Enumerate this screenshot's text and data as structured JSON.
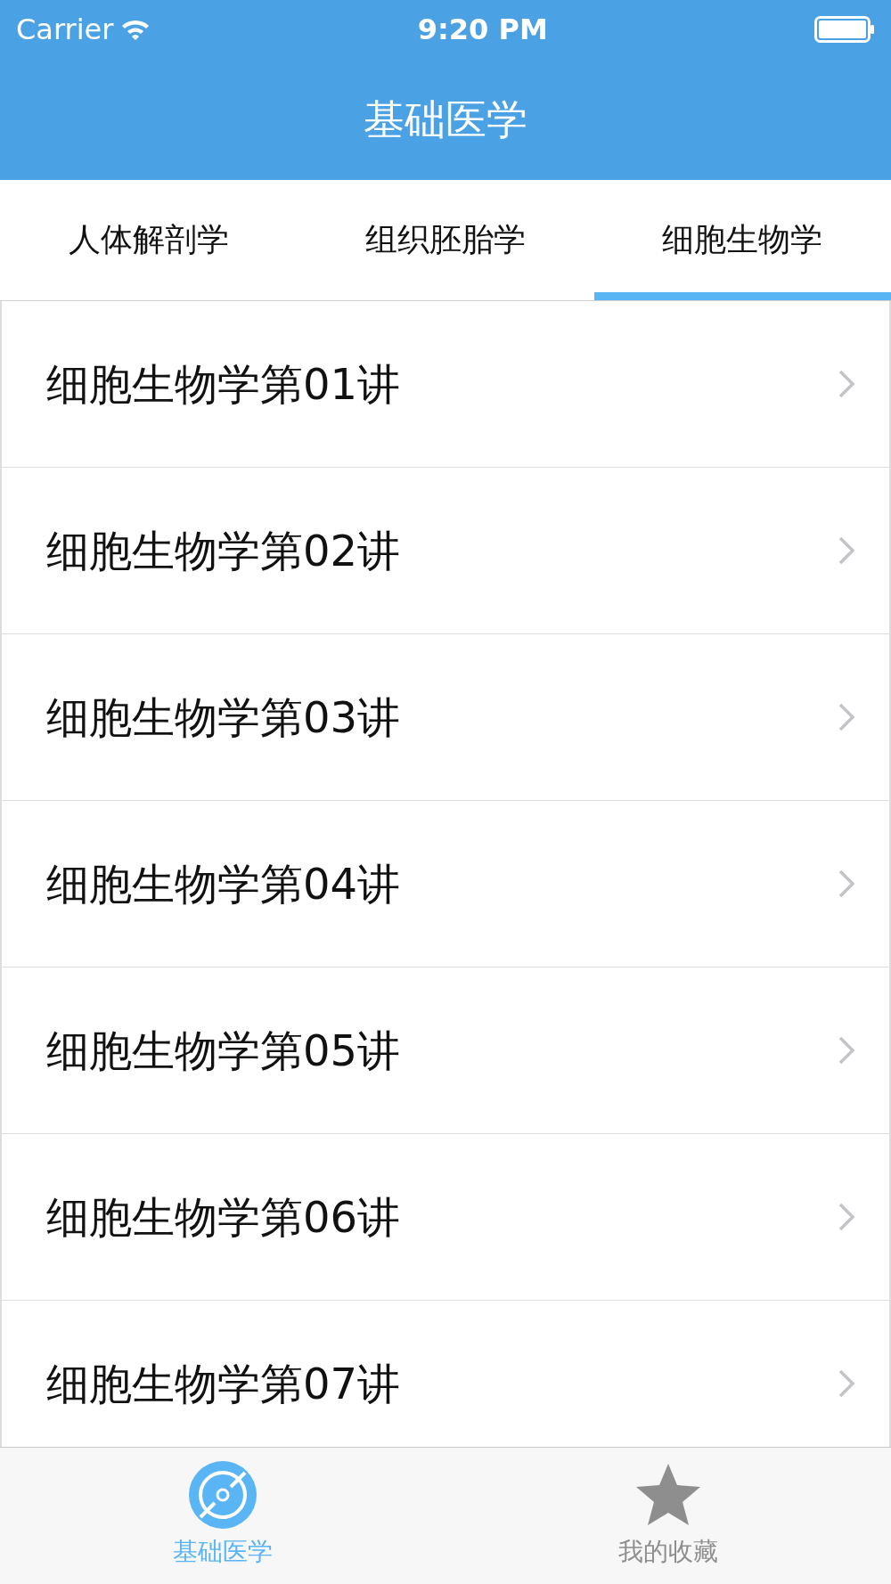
{
  "status_bar": {
    "carrier": "Carrier",
    "time": "9:20 PM"
  },
  "nav": {
    "title": "基础医学"
  },
  "tabs": [
    {
      "label": "人体解剖学",
      "selected": false
    },
    {
      "label": "组织胚胎学",
      "selected": false
    },
    {
      "label": "细胞生物学",
      "selected": true
    }
  ],
  "rows": [
    {
      "title": "细胞生物学第01讲"
    },
    {
      "title": "细胞生物学第02讲"
    },
    {
      "title": "细胞生物学第03讲"
    },
    {
      "title": "细胞生物学第04讲"
    },
    {
      "title": "细胞生物学第05讲"
    },
    {
      "title": "细胞生物学第06讲"
    },
    {
      "title": "细胞生物学第07讲"
    }
  ],
  "tab_bar": [
    {
      "label": "基础医学",
      "kind": "disc",
      "selected": true
    },
    {
      "label": "我的收藏",
      "kind": "star",
      "selected": false
    }
  ]
}
